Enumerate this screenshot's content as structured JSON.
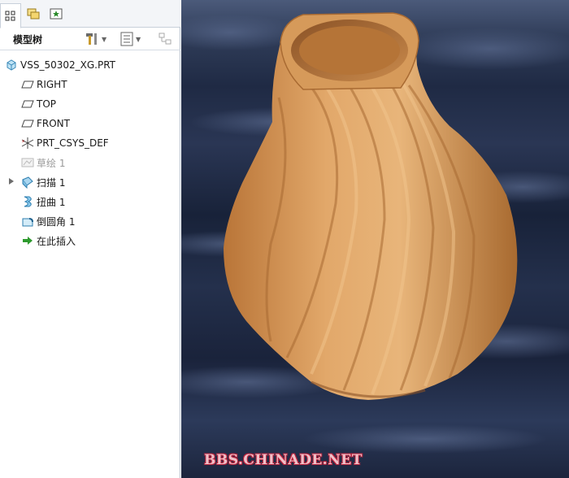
{
  "tabs": [
    {
      "name": "model-tree",
      "icon": "model-tree-icon",
      "active": true
    },
    {
      "name": "folder-browser",
      "icon": "folder-browser-icon",
      "active": false
    },
    {
      "name": "favorites",
      "icon": "favorites-icon",
      "active": false
    }
  ],
  "model_tree": {
    "title": "模型树",
    "settings_icon": "tools-icon",
    "show_icon": "list-icon",
    "filter_icon": "filter-icon",
    "items": [
      {
        "label": "VSS_50302_XG.PRT",
        "icon": "part-icon"
      },
      {
        "label": "RIGHT",
        "icon": "datum-plane-icon"
      },
      {
        "label": "TOP",
        "icon": "datum-plane-icon"
      },
      {
        "label": "FRONT",
        "icon": "datum-plane-icon"
      },
      {
        "label": "PRT_CSYS_DEF",
        "icon": "coordinate-system-icon"
      },
      {
        "label": "草绘 1",
        "icon": "sketch-icon",
        "suppressed": true
      },
      {
        "label": "扫描 1",
        "icon": "sweep-icon",
        "expandable": true
      },
      {
        "label": "扭曲 1",
        "icon": "twist-icon"
      },
      {
        "label": "倒圆角 1",
        "icon": "round-icon"
      },
      {
        "label": "在此插入",
        "icon": "insert-here-arrow-icon"
      }
    ]
  },
  "viewport": {
    "model_description": "twisted-vase",
    "watermark": "BBS.CHINADE.NET",
    "colors": {
      "wood_light": "#e2a86a",
      "wood_dark": "#b97538",
      "sky_dark": "#1f2a44"
    }
  }
}
